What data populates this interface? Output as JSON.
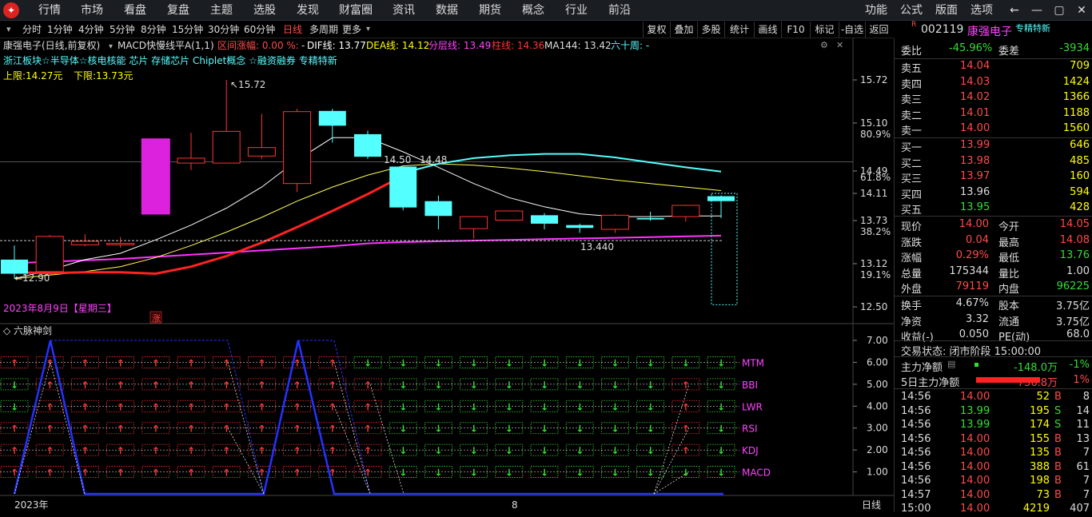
{
  "menubar": {
    "items": [
      "行情",
      "市场",
      "看盘",
      "复盘",
      "主题",
      "选股",
      "发现",
      "财富圈",
      "资讯",
      "数据",
      "期货",
      "概念",
      "行业",
      "前沿"
    ],
    "right": [
      "功能",
      "公式",
      "版面",
      "选项"
    ]
  },
  "periods": {
    "items": [
      "分时",
      "1分钟",
      "4分钟",
      "5分钟",
      "8分钟",
      "15分钟",
      "30分钟",
      "60分钟",
      "日线",
      "多周期",
      "更多"
    ],
    "active": "日线"
  },
  "toolbar": [
    "复权",
    "叠加",
    "多股",
    "统计",
    "画线",
    "F10",
    "标记",
    "-自选",
    "返回"
  ],
  "chart_header": {
    "line1": [
      {
        "t": "康强电子(日线,前复权)",
        "c": "#dddddd"
      },
      {
        "t": "MACD快慢线平A(1,1)",
        "c": "#dddddd"
      },
      {
        "t": "区间涨幅: 0.00 %:",
        "c": "#ff4a4a"
      },
      {
        "t": "-",
        "c": "#dddddd"
      },
      {
        "t": "DIF线: 13.77",
        "c": "#ffffff"
      },
      {
        "t": "DEA线: 14.12",
        "c": "#ffff00"
      },
      {
        "t": "分层线: 13.49",
        "c": "#ff44ff"
      },
      {
        "t": "柱线: 14.36",
        "c": "#ff3333"
      },
      {
        "t": "MA144: 13.42",
        "c": "#dddddd"
      },
      {
        "t": "六十周: -",
        "c": "#5ff"
      }
    ],
    "line2": "浙江板块☆半导体☆核电核能 芯片 存储芯片 Chiplet概念 ☆融资融券 专精特新",
    "upper": "上限:14.27元",
    "lower": "下限:13.73元",
    "date": "2023年8月9日【星期三】"
  },
  "main_chart": {
    "y_ticks": [
      "15.72",
      "15.10",
      "14.49",
      "14.11",
      "13.73",
      "13.12",
      "12.50"
    ],
    "pct_ticks": [
      "80.9%",
      "61.8%",
      "38.2%",
      "19.1%"
    ],
    "annotations": {
      "high": "15.72",
      "low": "12.90",
      "low2": "13.440",
      "l1": "14.50",
      "l2": "14.48"
    },
    "candles": [
      {
        "o": 12.97,
        "c": 13.17,
        "h": 13.37,
        "l": 12.9,
        "up": false,
        "cyan": true
      },
      {
        "o": 13.0,
        "c": 13.5,
        "h": 13.52,
        "l": 12.97,
        "up": true
      },
      {
        "o": 13.38,
        "c": 13.43,
        "h": 13.53,
        "l": 13.36,
        "up": true
      },
      {
        "o": 13.38,
        "c": 13.4,
        "h": 13.49,
        "l": 13.34,
        "up": true
      },
      {
        "o": 13.81,
        "c": 14.89,
        "h": 14.89,
        "l": 13.81,
        "up": true,
        "mag": true
      },
      {
        "o": 14.54,
        "c": 14.61,
        "h": 14.97,
        "l": 14.44,
        "up": true
      },
      {
        "o": 14.54,
        "c": 14.99,
        "h": 15.72,
        "l": 14.54,
        "up": true
      },
      {
        "o": 14.64,
        "c": 14.76,
        "h": 15.24,
        "l": 14.6,
        "up": true
      },
      {
        "o": 14.25,
        "c": 15.27,
        "h": 15.31,
        "l": 14.13,
        "up": true
      },
      {
        "o": 15.28,
        "c": 15.07,
        "h": 15.31,
        "l": 14.83,
        "up": false
      },
      {
        "o": 14.95,
        "c": 14.63,
        "h": 15.0,
        "l": 14.6,
        "up": false
      },
      {
        "o": 14.49,
        "c": 13.91,
        "h": 14.49,
        "l": 13.87,
        "up": false
      },
      {
        "o": 14.0,
        "c": 13.79,
        "h": 14.08,
        "l": 13.6,
        "up": false
      },
      {
        "o": 13.61,
        "c": 13.78,
        "h": 13.78,
        "l": 13.47,
        "up": true
      },
      {
        "o": 13.73,
        "c": 13.86,
        "h": 13.86,
        "l": 13.73,
        "up": true
      },
      {
        "o": 13.8,
        "c": 13.68,
        "h": 13.83,
        "l": 13.6,
        "up": false
      },
      {
        "o": 13.66,
        "c": 13.62,
        "h": 13.68,
        "l": 13.55,
        "up": false
      },
      {
        "o": 13.6,
        "c": 13.8,
        "h": 13.82,
        "l": 13.55,
        "up": true
      },
      {
        "o": 13.76,
        "c": 13.74,
        "h": 13.85,
        "l": 13.72,
        "up": false
      },
      {
        "o": 13.78,
        "c": 13.94,
        "h": 13.95,
        "l": 13.71,
        "up": true
      },
      {
        "o": 14.07,
        "c": 14.0,
        "h": 14.08,
        "l": 13.76,
        "up": false
      }
    ]
  },
  "indicator": {
    "title": "六脉神剑",
    "labels": [
      "MTM",
      "BBI",
      "LWR",
      "RSI",
      "KDJ",
      "MACD"
    ],
    "y_ticks": [
      "7.00",
      "6.00",
      "5.00",
      "4.00",
      "3.00",
      "2.00",
      "1.00"
    ],
    "x_labels": [
      "2023年",
      "8"
    ],
    "period_label": "日线"
  },
  "quote": {
    "code": "002119",
    "name": "康强电子",
    "tag": "专精特新",
    "weibi_label": "委比",
    "weibi": "-45.96%",
    "weicha_label": "委差",
    "weicha": "-3934",
    "asks": [
      {
        "label": "卖五",
        "price": "14.04",
        "vol": "709"
      },
      {
        "label": "卖四",
        "price": "14.03",
        "vol": "1424"
      },
      {
        "label": "卖三",
        "price": "14.02",
        "vol": "1366"
      },
      {
        "label": "卖二",
        "price": "14.01",
        "vol": "1188"
      },
      {
        "label": "卖一",
        "price": "14.00",
        "vol": "1560"
      }
    ],
    "bids": [
      {
        "label": "买一",
        "price": "13.99",
        "vol": "646"
      },
      {
        "label": "买二",
        "price": "13.98",
        "vol": "485"
      },
      {
        "label": "买三",
        "price": "13.97",
        "vol": "160"
      },
      {
        "label": "买四",
        "price": "13.96",
        "vol": "594"
      },
      {
        "label": "买五",
        "price": "13.95",
        "vol": "428"
      }
    ],
    "stats": [
      {
        "l1": "现价",
        "v1": "14.00",
        "c1": "#ff4a4a",
        "l2": "今开",
        "v2": "14.05",
        "c2": "#ff4a4a"
      },
      {
        "l1": "涨跌",
        "v1": "0.04",
        "c1": "#ff4a4a",
        "l2": "最高",
        "v2": "14.08",
        "c2": "#ff4a4a"
      },
      {
        "l1": "涨幅",
        "v1": "0.29%",
        "c1": "#ff4a4a",
        "l2": "最低",
        "v2": "13.76",
        "c2": "#33dd33"
      },
      {
        "l1": "总量",
        "v1": "175344",
        "c1": "#dddddd",
        "l2": "量比",
        "v2": "1.00",
        "c2": "#dddddd"
      },
      {
        "l1": "外盘",
        "v1": "79119",
        "c1": "#ff4a4a",
        "l2": "内盘",
        "v2": "96225",
        "c2": "#33dd33"
      }
    ],
    "stats2": [
      {
        "l1": "换手",
        "v1": "4.67%",
        "l2": "股本",
        "v2": "3.75亿"
      },
      {
        "l1": "净资",
        "v1": "3.32",
        "l2": "流通",
        "v2": "3.75亿"
      },
      {
        "l1": "收益(-)",
        "v1": "0.050",
        "l2": "PE(动)",
        "v2": "68.0"
      }
    ],
    "trade_state": "交易状态: 闭市阶段 15:00:00",
    "flows": [
      {
        "label": "主力净额",
        "value": "-148.0万",
        "pct": "-1%",
        "c": "#33dd33"
      },
      {
        "label": "5日主力净额",
        "value": "756.8万",
        "pct": "1%",
        "c": "#ff4a4a"
      }
    ],
    "ticks": [
      {
        "t": "14:56",
        "p": "14.00",
        "v": "52",
        "s": "B",
        "n": "8"
      },
      {
        "t": "14:56",
        "p": "13.99",
        "v": "195",
        "s": "S",
        "n": "14"
      },
      {
        "t": "14:56",
        "p": "13.99",
        "v": "174",
        "s": "S",
        "n": "11"
      },
      {
        "t": "14:56",
        "p": "14.00",
        "v": "155",
        "s": "B",
        "n": "13"
      },
      {
        "t": "14:56",
        "p": "14.00",
        "v": "135",
        "s": "B",
        "n": "7"
      },
      {
        "t": "14:56",
        "p": "14.00",
        "v": "388",
        "s": "B",
        "n": "61"
      },
      {
        "t": "14:56",
        "p": "14.00",
        "v": "198",
        "s": "B",
        "n": "7"
      },
      {
        "t": "14:57",
        "p": "14.00",
        "v": "73",
        "s": "B",
        "n": "7"
      },
      {
        "t": "15:00",
        "p": "14.00",
        "v": "4219",
        "s": "",
        "n": "407"
      }
    ]
  },
  "colors": {
    "up": "#ff3333",
    "down": "#54ffff",
    "accent": "#ff4a4a",
    "green": "#33dd33"
  }
}
